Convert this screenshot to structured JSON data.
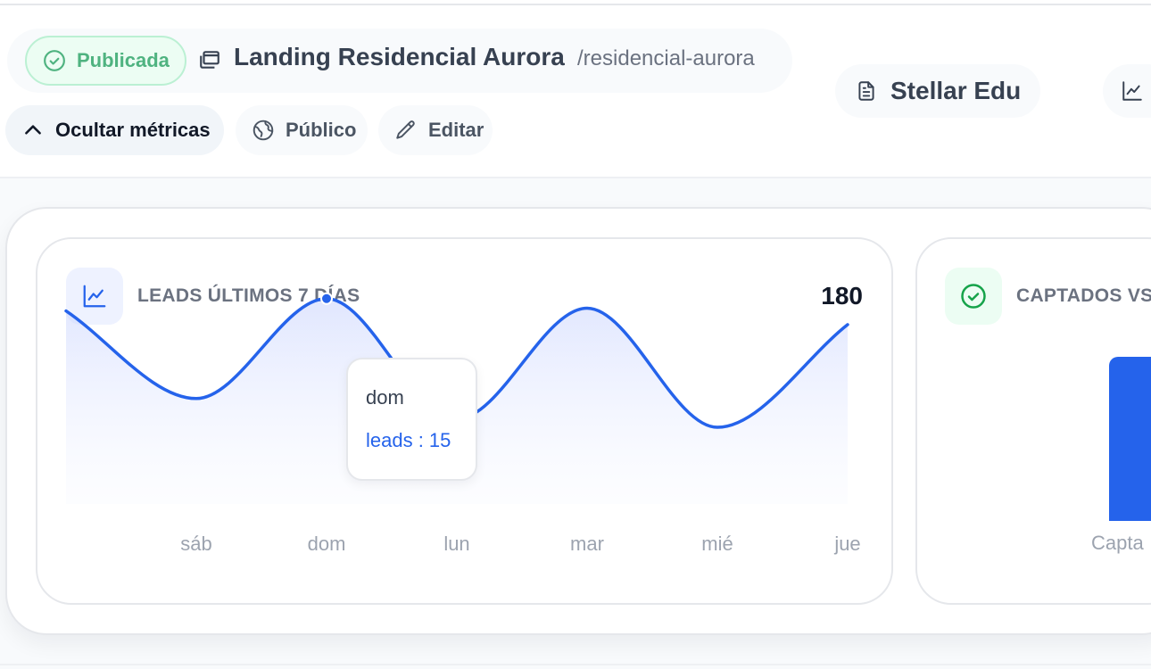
{
  "header": {
    "status": "Publicada",
    "page_title": "Landing Residencial Aurora",
    "slug": "/residencial-aurora",
    "project": "Stellar Edu"
  },
  "actions": {
    "hide_metrics": "Ocultar métricas",
    "public": "Público",
    "edit": "Editar"
  },
  "metrics": {
    "leads_card": {
      "title": "LEADS ÚLTIMOS 7 DÍAS",
      "total": "180"
    },
    "captados_card": {
      "title": "CAPTADOS VS",
      "x_label": "Capta"
    },
    "tooltip": {
      "day": "dom",
      "value": "leads : 15"
    }
  },
  "colors": {
    "accent": "#2563eb",
    "success": "#16a34a",
    "status_text": "#4fb380"
  },
  "chart_data": [
    {
      "type": "area",
      "title": "LEADS ÚLTIMOS 7 DÍAS",
      "categories": [
        "",
        "sáb",
        "dom",
        "lun",
        "mar",
        "mié",
        "jue"
      ],
      "series": [
        {
          "name": "leads",
          "values": [
            14.1,
            7.7,
            15,
            6.2,
            14.3,
            5.6,
            13.1
          ]
        }
      ],
      "ylim": [
        0,
        20
      ],
      "grid": false,
      "highlighted": {
        "category": "dom",
        "value": 15
      }
    }
  ]
}
